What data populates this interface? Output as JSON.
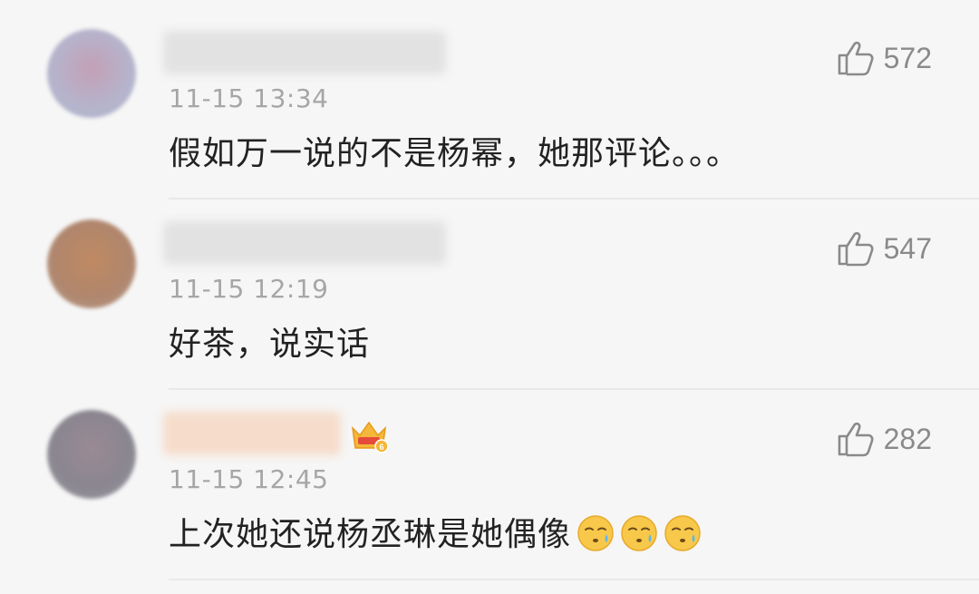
{
  "comments": [
    {
      "time": "11-15 13:34",
      "text": "假如万一说的不是杨幂，她那评论。。。",
      "likes": "572",
      "avatar_color": "#b9b2c9",
      "username_width": 312,
      "has_crown": false,
      "emoji_count": 0
    },
    {
      "time": "11-15 12:19",
      "text": "好茶，说实话",
      "likes": "547",
      "avatar_color": "#b88a6c",
      "username_width": 312,
      "has_crown": false,
      "emoji_count": 0
    },
    {
      "time": "11-15 12:45",
      "text": "上次她还说杨丞琳是她偶像",
      "likes": "282",
      "avatar_color": "#8d8a93",
      "username_width": 196,
      "has_crown": true,
      "emoji_count": 3
    }
  ],
  "icons": {
    "like": "thumbs-up-outline-icon",
    "crown": "vip-crown-icon",
    "emoji": "sweat-face-emoji"
  },
  "colors": {
    "username_blur_gray": "#e0e0e0",
    "username_blur_peach": "#f6dcca",
    "crown_gold": "#f4b73a",
    "crown_red": "#e54b3c"
  }
}
